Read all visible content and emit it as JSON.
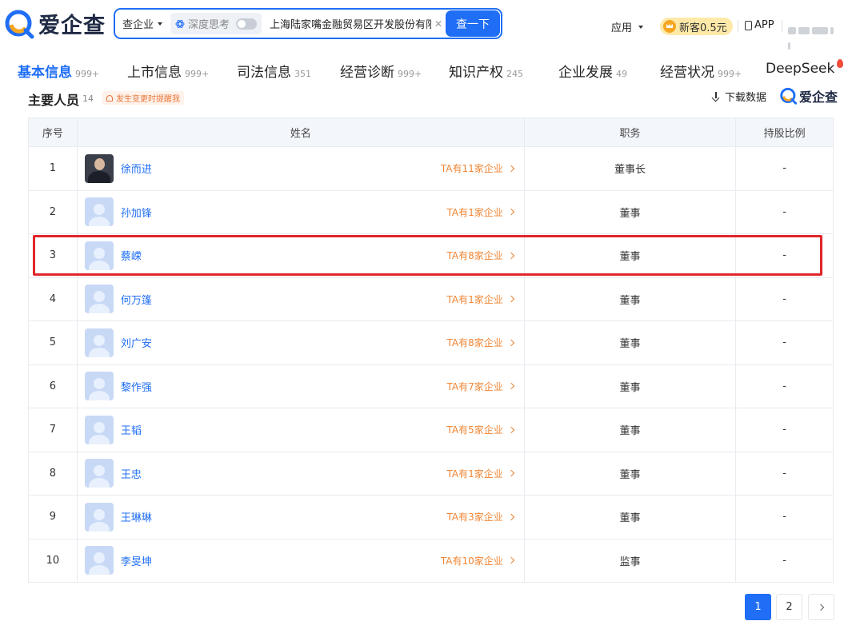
{
  "brand": {
    "name": "爱企查"
  },
  "search": {
    "scope_label": "查企业",
    "deep_think_label": "深度思考",
    "query": "上海陆家嘴金融贸易区开发股份有限公",
    "button_label": "查一下"
  },
  "nav": {
    "apps_label": "应用",
    "newbie_label": "新客0.5元",
    "app_label": "APP"
  },
  "tabs": [
    {
      "label": "基本信息",
      "count": "999+"
    },
    {
      "label": "上市信息",
      "count": "999+"
    },
    {
      "label": "司法信息",
      "count": "351"
    },
    {
      "label": "经营诊断",
      "count": "999+"
    },
    {
      "label": "知识产权",
      "count": "245"
    },
    {
      "label": "企业发展",
      "count": "49"
    },
    {
      "label": "经营状况",
      "count": "999+"
    },
    {
      "label": "DeepSeek",
      "count": ""
    }
  ],
  "section": {
    "title": "主要人员",
    "count": "14",
    "remind_label": "发生变更时提醒我",
    "download_label": "下载数据"
  },
  "table": {
    "headers": [
      "序号",
      "姓名",
      "职务",
      "持股比例"
    ],
    "rows": [
      {
        "no": "1",
        "name": "徐而进",
        "companies": "TA有11家企业",
        "role": "董事长",
        "share": "-"
      },
      {
        "no": "2",
        "name": "孙加锋",
        "companies": "TA有1家企业",
        "role": "董事",
        "share": "-"
      },
      {
        "no": "3",
        "name": "蔡嵘",
        "companies": "TA有8家企业",
        "role": "董事",
        "share": "-"
      },
      {
        "no": "4",
        "name": "何万篷",
        "companies": "TA有1家企业",
        "role": "董事",
        "share": "-"
      },
      {
        "no": "5",
        "name": "刘广安",
        "companies": "TA有8家企业",
        "role": "董事",
        "share": "-"
      },
      {
        "no": "6",
        "name": "黎作强",
        "companies": "TA有7家企业",
        "role": "董事",
        "share": "-"
      },
      {
        "no": "7",
        "name": "王韬",
        "companies": "TA有5家企业",
        "role": "董事",
        "share": "-"
      },
      {
        "no": "8",
        "name": "王忠",
        "companies": "TA有1家企业",
        "role": "董事",
        "share": "-"
      },
      {
        "no": "9",
        "name": "王琳琳",
        "companies": "TA有3家企业",
        "role": "董事",
        "share": "-"
      },
      {
        "no": "10",
        "name": "李旻坤",
        "companies": "TA有10家企业",
        "role": "监事",
        "share": "-"
      }
    ]
  },
  "pagination": {
    "pages": [
      "1",
      "2"
    ],
    "current": "1"
  },
  "colors": {
    "accent": "#1f6ef5",
    "orange": "#f08534",
    "highlight": "#e0262a"
  }
}
